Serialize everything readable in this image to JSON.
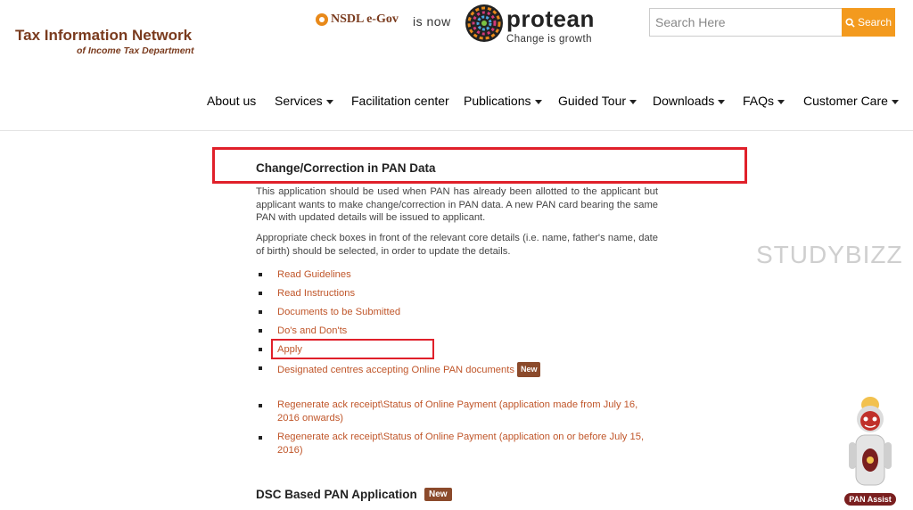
{
  "header": {
    "brand_title": "Tax Information Network",
    "brand_subtitle": "of Income Tax Department",
    "partner_logo_text": "NSDL e-Gov",
    "is_now": "is now",
    "protean_name": "protean",
    "protean_tagline": "Change is growth"
  },
  "search": {
    "placeholder": "Search Here",
    "button_label": "Search"
  },
  "nav": {
    "items": [
      {
        "label": "About us",
        "dropdown": false
      },
      {
        "label": "Services",
        "dropdown": true
      },
      {
        "label": "Facilitation center",
        "dropdown": false
      },
      {
        "label": "Publications",
        "dropdown": true
      },
      {
        "label": "Guided Tour",
        "dropdown": true
      },
      {
        "label": "Downloads",
        "dropdown": true
      },
      {
        "label": "FAQs",
        "dropdown": true
      },
      {
        "label": "Customer Care",
        "dropdown": true
      }
    ]
  },
  "content": {
    "title": "Change/Correction in PAN Data",
    "paragraph1": "This application should be used when PAN has already been allotted to the applicant but applicant wants to make change/correction in PAN data. A new PAN card bearing the same PAN with updated details will be issued to applicant.",
    "paragraph2": "Appropriate check boxes in front of the relevant core details (i.e. name, father's name, date of birth) should be selected, in order to update the details.",
    "links": [
      "Read Guidelines",
      "Read Instructions",
      "Documents to be Submitted",
      "Do's and Don'ts",
      "Apply",
      "Designated centres accepting Online PAN documents"
    ],
    "new_badge": "New",
    "regen_links": [
      "Regenerate ack receipt\\Status of Online Payment (application made from July 16, 2016 onwards)",
      "Regenerate ack receipt\\Status of Online Payment (application on or before July 15, 2016)"
    ],
    "dsc_title": "DSC Based PAN Application",
    "dsc_badge": "New"
  },
  "watermark": "STUDYBIZZ",
  "assistant": {
    "label": "PAN Assist"
  },
  "colors": {
    "brand": "#7a3b1e",
    "link": "#c0562a",
    "highlight": "#e0202a",
    "search_button": "#f39a1e",
    "badge": "#8b4a2b"
  }
}
